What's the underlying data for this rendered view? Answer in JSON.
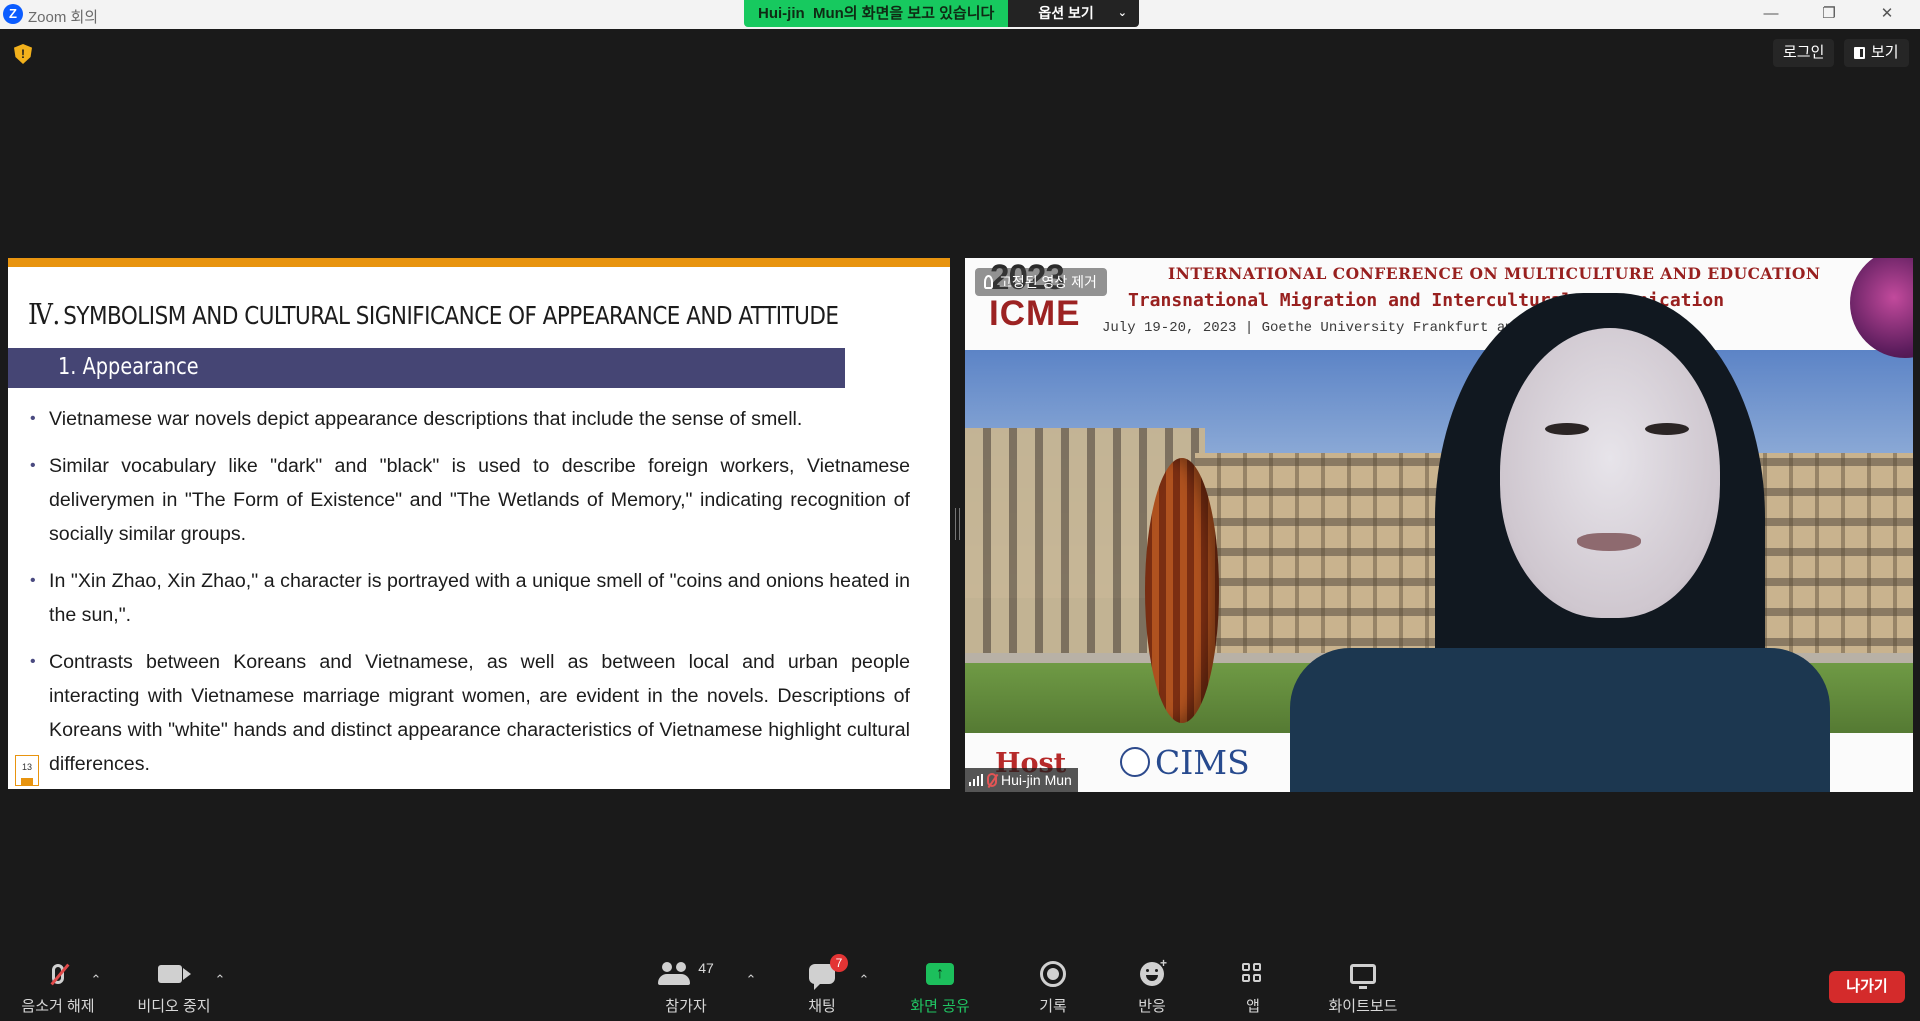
{
  "window": {
    "app_title": "Zoom 회의",
    "logo_letter": "Z",
    "share_status": "Hui-jin  Mun의 화면을 보고 있습니다",
    "view_options_label": "옵션 보기",
    "minimize_glyph": "—",
    "restore_glyph": "❐",
    "close_glyph": "✕"
  },
  "topbar": {
    "security_badge": "!",
    "login_label": "로그인",
    "view_label": "보기"
  },
  "slide": {
    "heading_numeral": "Ⅳ.",
    "heading": "SYMBOLISM AND CULTURAL SIGNIFICANCE OF APPEARANCE AND ATTITUDE",
    "subheading": "1. Appearance",
    "bullets": [
      "Vietnamese war novels depict appearance descriptions that include the sense of smell.",
      "Similar vocabulary like \"dark\" and \"black\" is used to describe foreign workers, Vietnamese deliverymen in \"The Form of Existence\" and \"The Wetlands of Memory,\" indicating recognition of socially similar groups.",
      "In \"Xin Zhao, Xin Zhao,\" a character is portrayed with a unique smell of \"coins and onions heated in the sun,\".",
      "Contrasts between Koreans and Vietnamese, as well as between local and urban people interacting with Vietnamese marriage migrant women, are evident in the novels. Descriptions of Koreans with \"white\" hands and distinct appearance characteristics of Vietnamese highlight cultural differences."
    ],
    "page_number": "13"
  },
  "video": {
    "remove_background_label": "고정된 영상 제거",
    "event_year": "2023",
    "event_acronym": "ICME",
    "conference_title": "INTERNATIONAL CONFERENCE ON MULTICULTURE AND EDUCATION",
    "conference_subtitle": "Transnational Migration and Intercultural Communication",
    "conference_date": "July 19-20, 2023 | Goethe University Frankfurt am Main, Germany",
    "host_label": "Host",
    "host_org": "CIMS",
    "participant_name": "Hui-jin Mun"
  },
  "toolbar": {
    "unmute_label": "음소거 해제",
    "stop_video_label": "비디오 중지",
    "participants_label": "참가자",
    "participants_count": "47",
    "chat_label": "채팅",
    "chat_badge": "7",
    "share_screen_label": "화면 공유",
    "share_arrow": "↑",
    "record_label": "기록",
    "reactions_label": "반응",
    "reactions_plus": "+",
    "apps_label": "앱",
    "whiteboard_label": "화이트보드",
    "leave_label": "나가기",
    "caret_glyph": "⌃"
  },
  "colors": {
    "accent_green": "#1cbf5c",
    "slide_orange": "#e8940f",
    "slide_purple": "#454574",
    "leave_red": "#d42b2b"
  }
}
